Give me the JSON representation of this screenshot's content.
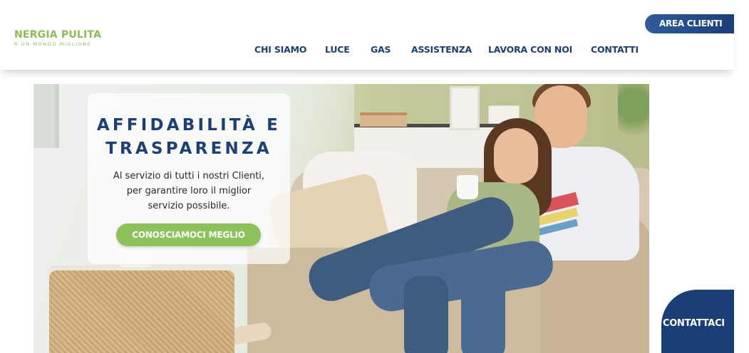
{
  "brand": {
    "name": "NERGIA PULITA",
    "tagline": "R UN MONDO MIGLIORE"
  },
  "nav": {
    "items": [
      {
        "label": "CHI SIAMO"
      },
      {
        "label": "LUCE"
      },
      {
        "label": "GAS"
      },
      {
        "label": "ASSISTENZA"
      },
      {
        "label": "LAVORA CON NOI"
      },
      {
        "label": "CONTATTI"
      }
    ],
    "area_clienti": "AREA CLIENTI"
  },
  "hero": {
    "title_line1": "AFFIDABILITÀ E",
    "title_line2": "TRASPARENZA",
    "subtitle_line1": "Al servizio di tutti i nostri Clienti,",
    "subtitle_line2": "per garantire loro il miglior",
    "subtitle_line3": "servizio possibile.",
    "cta_label": "CONOSCIAMOCI MEGLIO"
  },
  "contact_bubble": {
    "label": "CONTATTACI"
  },
  "colors": {
    "primary_blue": "#1c3e77",
    "accent_green": "#8cc15c",
    "logo_green": "#8cbd55"
  }
}
